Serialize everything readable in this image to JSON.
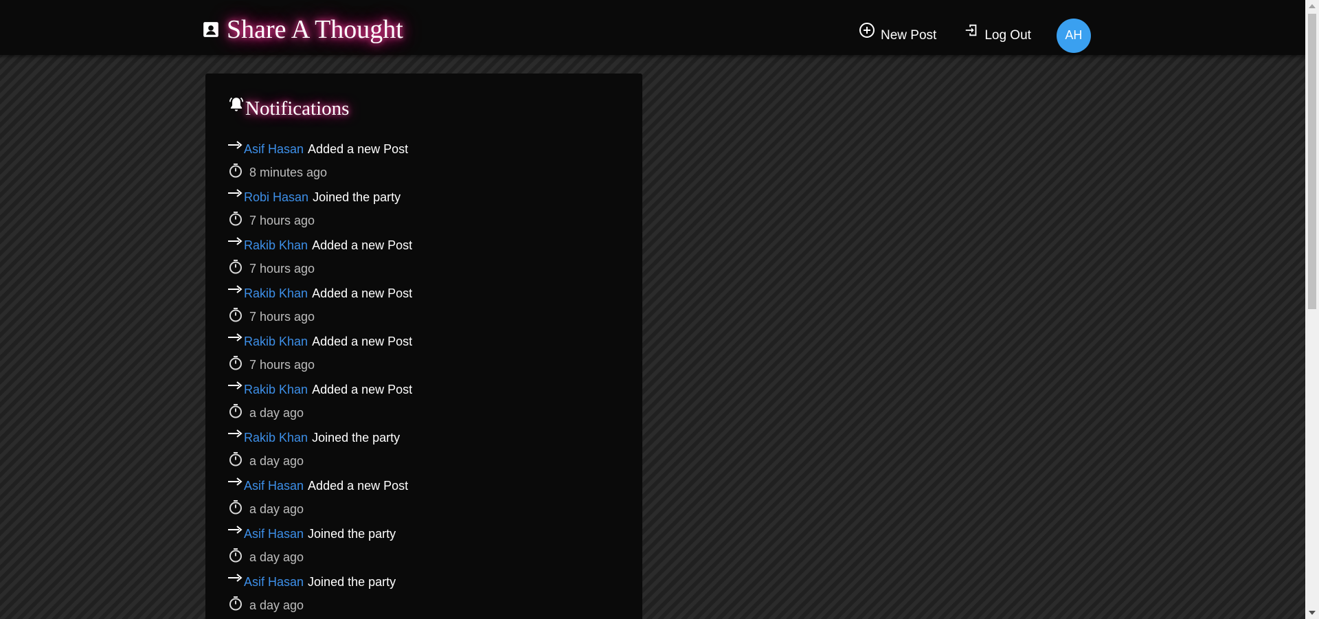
{
  "header": {
    "title": "Share A Thought",
    "logo_icon": "contact-card-icon",
    "new_post_label": "New Post",
    "logout_label": "Log Out",
    "avatar_initials": "AH",
    "accent_color": "#ff1a8c",
    "avatar_color": "#3aa0f0"
  },
  "notifications": {
    "title": "Notifications",
    "icon": "bell-icon",
    "link_color": "#3d8fe8",
    "items": [
      {
        "user": "Asif Hasan",
        "action": "Added a new Post",
        "time": "8 minutes ago"
      },
      {
        "user": "Robi Hasan",
        "action": "Joined the party",
        "time": "7 hours ago"
      },
      {
        "user": "Rakib Khan",
        "action": "Added a new Post",
        "time": "7 hours ago"
      },
      {
        "user": "Rakib Khan",
        "action": "Added a new Post",
        "time": "7 hours ago"
      },
      {
        "user": "Rakib Khan",
        "action": "Added a new Post",
        "time": "7 hours ago"
      },
      {
        "user": "Rakib Khan",
        "action": "Added a new Post",
        "time": "a day ago"
      },
      {
        "user": "Rakib Khan",
        "action": "Joined the party",
        "time": "a day ago"
      },
      {
        "user": "Asif Hasan",
        "action": "Added a new Post",
        "time": "a day ago"
      },
      {
        "user": "Asif Hasan",
        "action": "Joined the party",
        "time": "a day ago"
      },
      {
        "user": "Asif Hasan",
        "action": "Joined the party",
        "time": "a day ago"
      }
    ]
  }
}
